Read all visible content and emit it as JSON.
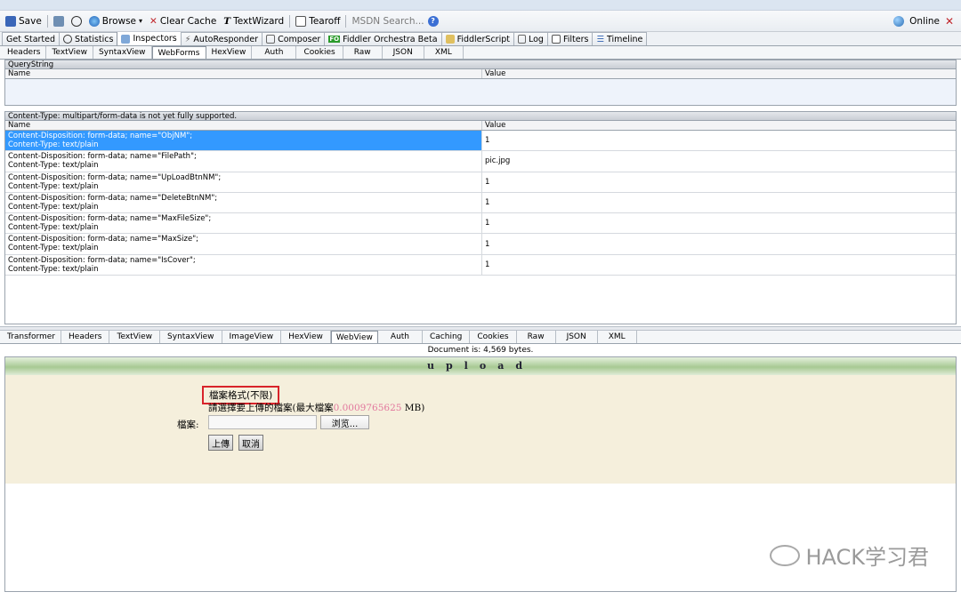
{
  "toolbar": {
    "save": "Save",
    "browse": "Browse",
    "clear_cache": "Clear Cache",
    "text_wizard": "TextWizard",
    "tearoff": "Tearoff",
    "msdn_search": "MSDN Search...",
    "online": "Online"
  },
  "main_tabs": [
    {
      "label": "Get Started"
    },
    {
      "label": "Statistics"
    },
    {
      "label": "Inspectors"
    },
    {
      "label": "AutoResponder"
    },
    {
      "label": "Composer"
    },
    {
      "label": "Fiddler Orchestra Beta"
    },
    {
      "label": "FiddlerScript"
    },
    {
      "label": "Log"
    },
    {
      "label": "Filters"
    },
    {
      "label": "Timeline"
    }
  ],
  "request_tabs": [
    "Headers",
    "TextView",
    "SyntaxView",
    "WebForms",
    "HexView",
    "Auth",
    "Cookies",
    "Raw",
    "JSON",
    "XML"
  ],
  "querystring": {
    "header": "QueryString",
    "col_name": "Name",
    "col_value": "Value"
  },
  "formdata": {
    "header": "Content-Type: multipart/form-data is not yet fully supported.",
    "col_name": "Name",
    "col_value": "Value",
    "rows": [
      {
        "line1": "Content-Disposition: form-data; name=\"ObjNM\";",
        "line2": "Content-Type: text/plain",
        "value": "1"
      },
      {
        "line1": "Content-Disposition: form-data; name=\"FilePath\";",
        "line2": "Content-Type: text/plain",
        "value": "pic.jpg"
      },
      {
        "line1": "Content-Disposition: form-data; name=\"UpLoadBtnNM\";",
        "line2": "Content-Type: text/plain",
        "value": "1"
      },
      {
        "line1": "Content-Disposition: form-data; name=\"DeleteBtnNM\";",
        "line2": "Content-Type: text/plain",
        "value": "1"
      },
      {
        "line1": "Content-Disposition: form-data; name=\"MaxFileSize\";",
        "line2": "Content-Type: text/plain",
        "value": "1"
      },
      {
        "line1": "Content-Disposition: form-data; name=\"MaxSize\";",
        "line2": "Content-Type: text/plain",
        "value": "1"
      },
      {
        "line1": "Content-Disposition: form-data; name=\"IsCover\";",
        "line2": "Content-Type: text/plain",
        "value": "1"
      }
    ]
  },
  "response_tabs": [
    "Transformer",
    "Headers",
    "TextView",
    "SyntaxView",
    "ImageView",
    "HexView",
    "WebView",
    "Auth",
    "Caching",
    "Cookies",
    "Raw",
    "JSON",
    "XML"
  ],
  "document_info": "Document is: 4,569 bytes.",
  "webview": {
    "heading": "upload",
    "file_format": "檔案格式(不限)",
    "instruction_prefix": "請選擇要上傳的檔案(最大檔案",
    "max_size": "0.0009765625",
    "instruction_suffix": " MB)",
    "file_label": "檔案:",
    "browse_button": "浏览...",
    "upload_button": "上傳",
    "cancel_button": "取消"
  },
  "watermark": "HACK学习君",
  "colors": {
    "selection": "#3399ff",
    "webview_bg": "#f5efdc",
    "highlight_box": "#d8232a",
    "max_size_text": "#e2779d"
  }
}
